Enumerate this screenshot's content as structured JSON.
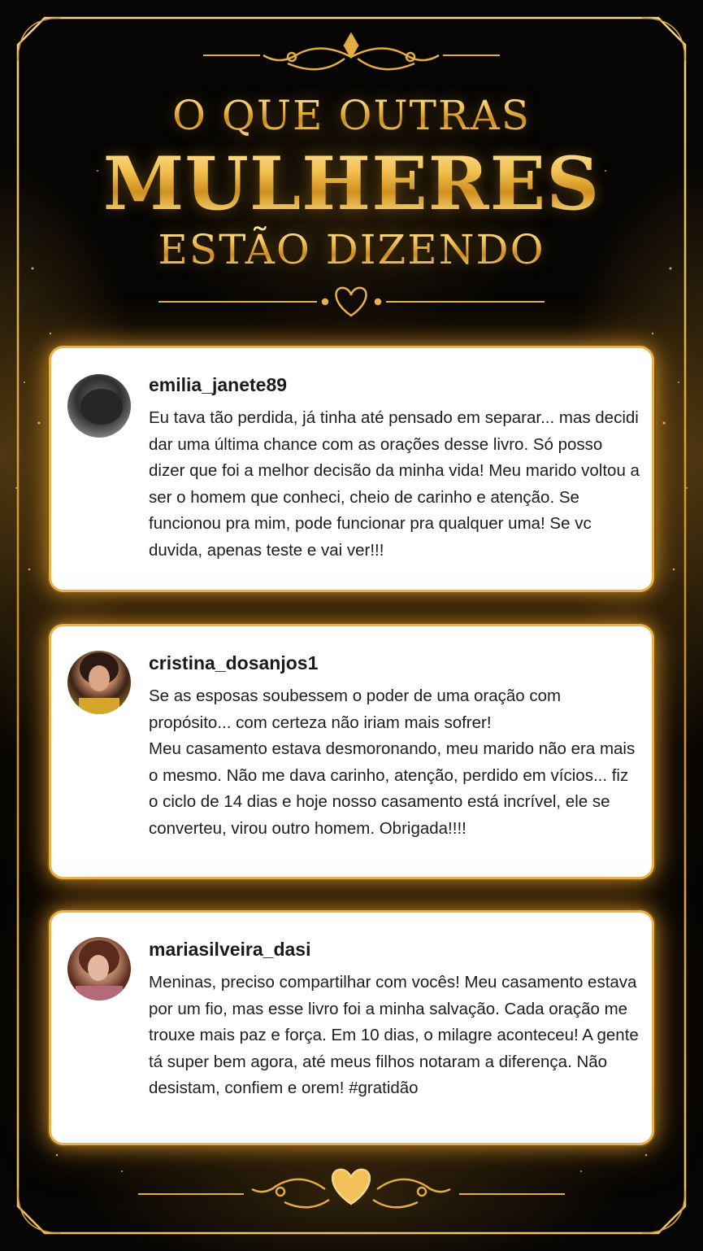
{
  "header": {
    "line1": "O QUE OUTRAS",
    "line2": "MULHERES",
    "line3": "ESTÃO DIZENDO"
  },
  "colors": {
    "gold": "#e8b24a",
    "background": "#060504",
    "card": "#ffffff"
  },
  "testimonials": [
    {
      "username": "emilia_janete89",
      "text": "Eu tava tão perdida, já tinha até pensado em separar... mas decidi dar uma última chance com as orações desse livro. Só posso dizer que foi a melhor decisão da minha vida! Meu marido voltou a ser o homem que conheci, cheio de carinho e atenção. Se funcionou pra mim, pode funcionar pra qualquer uma! Se vc duvida, apenas teste e vai ver!!!"
    },
    {
      "username": "cristina_dosanjos1",
      "text": "Se as esposas soubessem o poder de uma oração com propósito... com certeza não iriam mais sofrer!\nMeu casamento estava desmoronando, meu marido não era mais o mesmo. Não me dava carinho, atenção, perdido em vícios... fiz o ciclo de 14 dias e hoje nosso casamento está incrível, ele se converteu, virou outro homem. Obrigada!!!!"
    },
    {
      "username": "mariasilveira_dasi",
      "text": "Meninas, preciso compartilhar com vocês! Meu casamento estava por um fio, mas esse livro foi a minha salvação. Cada oração me trouxe mais paz e força. Em 10 dias, o milagre aconteceu! A gente tá super bem agora, até meus filhos notaram a diferença. Não desistam, confiem e orem! #gratidão"
    }
  ]
}
